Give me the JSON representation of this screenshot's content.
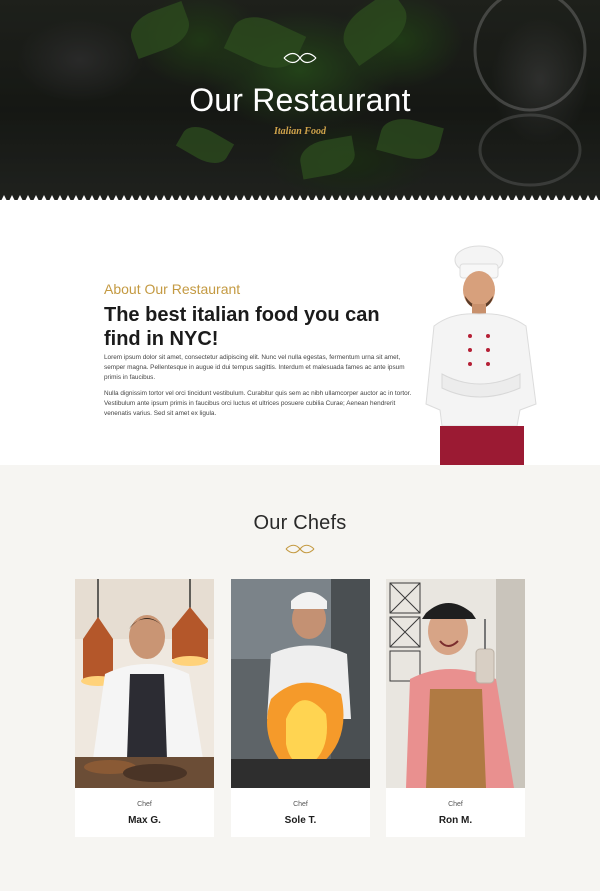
{
  "hero": {
    "title": "Our Restaurant",
    "subtitle": "Italian Food",
    "ornament_icon": "flourish-icon",
    "accent_color": "#d0a44b"
  },
  "about": {
    "kicker": "About Our Restaurant",
    "heading": "The best italian food you can find in NYC!",
    "paragraph_1": "Lorem ipsum dolor sit amet, consectetur adipiscing elit. Nunc vel nulla egestas, fermentum urna sit amet, semper magna. Pellentesque in augue id dui tempus sagittis. Interdum et malesuada fames ac ante ipsum primis in faucibus.",
    "paragraph_2": "Nulla dignissim tortor vel orci tincidunt vestibulum. Curabitur quis sem ac nibh ullamcorper auctor ac in tortor. Vestibulum ante ipsum primis in faucibus orci luctus et ultrices posuere cubilia Curae; Aenean hendrerit venenatis varius. Sed sit amet ex ligula.",
    "kicker_color": "#c49a42"
  },
  "chefs": {
    "title": "Our Chefs",
    "ornament_icon": "flourish-icon",
    "cards": [
      {
        "role": "Chef",
        "name": "Max G."
      },
      {
        "role": "Chef",
        "name": "Sole T."
      },
      {
        "role": "Chef",
        "name": "Ron M."
      }
    ]
  }
}
